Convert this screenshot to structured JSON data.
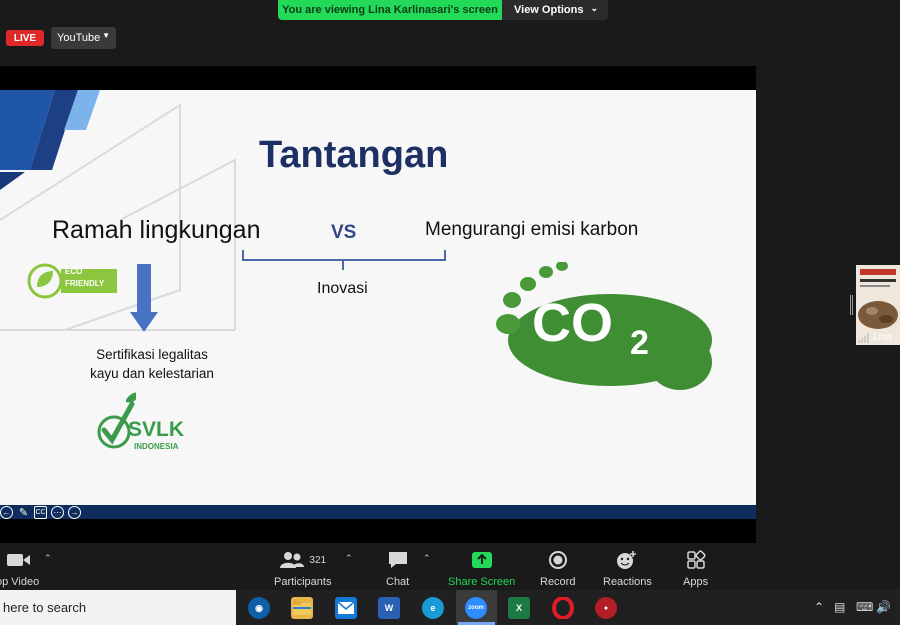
{
  "banner": {
    "viewing_text": "You are viewing Lina Karlinasari's screen",
    "view_options_label": "View Options"
  },
  "stream": {
    "live_label": "LIVE",
    "platform_label": "YouTube"
  },
  "slide": {
    "title": "Tantangan",
    "left_heading": "Ramah lingkungan",
    "vs_label": "VS",
    "right_heading": "Mengurangi emisi karbon",
    "middle_label": "Inovasi",
    "eco_badge_line1": "ECO",
    "eco_badge_line2": "FRIENDLY",
    "certification_line1": "Sertifikasi legalitas",
    "certification_line2": "kayu dan kelestarian",
    "svlk_label": "SVLK",
    "svlk_sub": "INDONESIA",
    "co2_label": "CO",
    "co2_sub": "2",
    "colors": {
      "title": "#1d2f63",
      "arrow": "#4a72c4",
      "green": "#3a9b4b",
      "footer": "#0e2c5c"
    }
  },
  "side_participant": {
    "name": "Lina"
  },
  "toolbar": {
    "video_label": "op Video",
    "participants_count": "321",
    "participants_label": "Participants",
    "chat_label": "Chat",
    "share_label": "Share Screen",
    "record_label": "Record",
    "reactions_label": "Reactions",
    "apps_label": "Apps",
    "share_color": "#23d959"
  },
  "taskbar": {
    "search_placeholder": "here to search",
    "zoom_label": "zoom"
  }
}
